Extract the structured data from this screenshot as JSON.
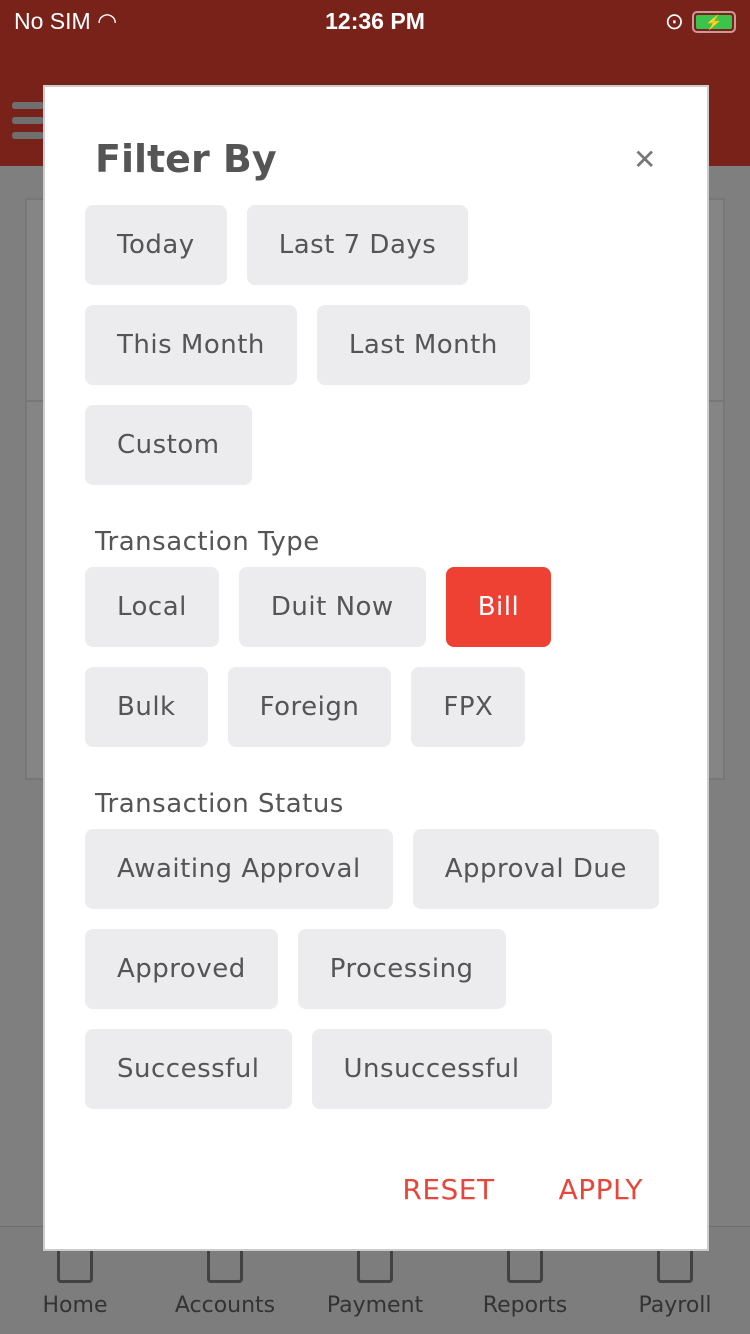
{
  "status_bar": {
    "carrier": "No SIM",
    "time": "12:36 PM"
  },
  "tab_bar": [
    {
      "label": "Home"
    },
    {
      "label": "Accounts"
    },
    {
      "label": "Payment"
    },
    {
      "label": "Reports"
    },
    {
      "label": "Payroll"
    }
  ],
  "modal": {
    "title": "Filter By",
    "date_filters": [
      "Today",
      "Last 7 Days",
      "This Month",
      "Last Month",
      "Custom"
    ],
    "transaction_type": {
      "label": "Transaction Type",
      "options": [
        "Local",
        "Duit Now",
        "Bill",
        "Bulk",
        "Foreign",
        "FPX"
      ],
      "selected": "Bill"
    },
    "transaction_status": {
      "label": "Transaction Status",
      "options": [
        "Awaiting Approval",
        "Approval Due",
        "Approved",
        "Processing",
        "Successful",
        "Unsuccessful"
      ]
    },
    "reset_label": "RESET",
    "apply_label": "APPLY"
  },
  "colors": {
    "accent": "#ee4033",
    "header": "#78221a"
  }
}
